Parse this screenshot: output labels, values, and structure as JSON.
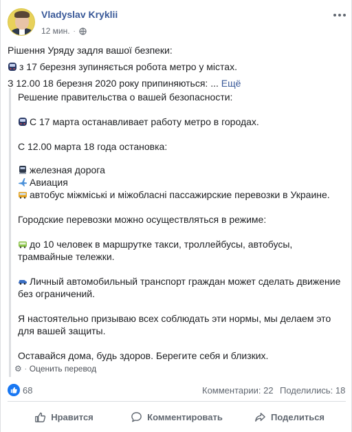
{
  "post": {
    "author": "Vladyslav Kryklii",
    "timestamp": "12 мин.",
    "separator": "·",
    "privacy_icon": "globe-icon",
    "menu_icon": "more-options-icon"
  },
  "original_text": {
    "line1": "Рішення Уряду задля вашої безпеки:",
    "line2": "з 17 березня зупиняється робота метро у містах.",
    "line3": "З 12.00 18 березня 2020 року припиняються: ...",
    "see_more": "Ещё"
  },
  "translation": {
    "lines": [
      "Решение правительства о вашей безопасности:",
      "С 17 марта останавливает работу метро в городах.",
      "С 12.00 марта 18 года остановка:",
      "железная дорога",
      "Авиация",
      "автобус міжміські и міжобласні пассажирские перевозки в Украине.",
      "Городские перевозки можно осуществляться в режиме:",
      "до 10 человек в маршрутке такси, троллейбусы, автобусы,",
      "трамвайные тележки.",
      "Личный автомобильный транспорт граждан может сделать движение",
      "без ограничений.",
      "Я настоятельно призываю всех соблюдать эти нормы, мы делаем это",
      "для вашей защиты.",
      "Оставайся дома, будь здоров. Берегите себя и близких."
    ],
    "rate_label": "Оценить перевод",
    "rate_icon": "gear-icon"
  },
  "stats": {
    "likes": "68",
    "comments": "Комментарии: 22",
    "shares": "Поделились: 18"
  },
  "actions": {
    "like": "Нравится",
    "comment": "Комментировать",
    "share": "Поделиться"
  },
  "colors": {
    "link": "#385898",
    "like_blue": "#1877f2",
    "secondary_text": "#606770"
  }
}
